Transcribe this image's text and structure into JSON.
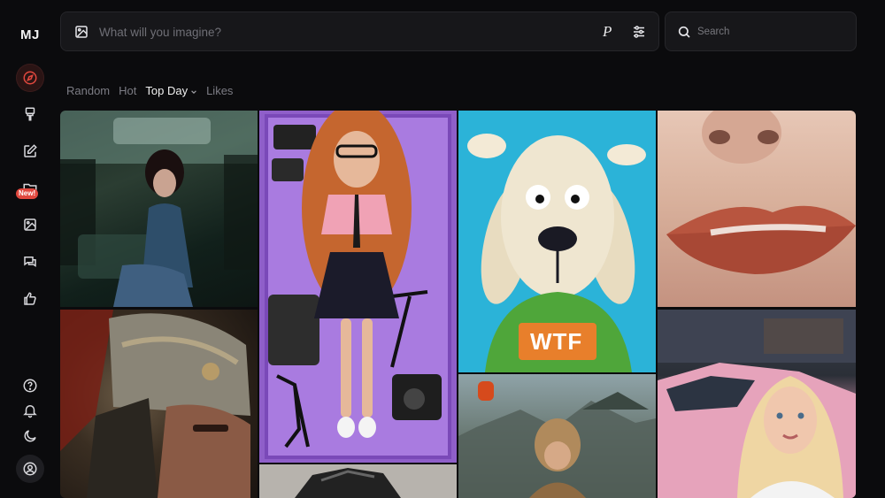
{
  "app": {
    "logo": "MJ"
  },
  "sidebar": {
    "items": [
      {
        "name": "explore",
        "icon": "compass-icon",
        "active": true
      },
      {
        "name": "create",
        "icon": "brush-icon"
      },
      {
        "name": "edit",
        "icon": "edit-icon"
      },
      {
        "name": "personalize",
        "icon": "folder-icon",
        "badge": "New!"
      },
      {
        "name": "organize",
        "icon": "image-icon"
      },
      {
        "name": "chat",
        "icon": "chat-icon"
      },
      {
        "name": "rank",
        "icon": "thumbs-up-icon"
      }
    ],
    "bottom": [
      {
        "name": "help",
        "icon": "help-icon"
      },
      {
        "name": "notifications",
        "icon": "bell-icon"
      },
      {
        "name": "theme",
        "icon": "moon-icon"
      },
      {
        "name": "account",
        "icon": "user-icon"
      }
    ]
  },
  "prompt": {
    "placeholder": "What will you imagine?",
    "p_label": "P"
  },
  "search": {
    "placeholder": "Search"
  },
  "filters": {
    "items": [
      "Random",
      "Hot",
      "Top Day",
      "Likes"
    ],
    "active": "Top Day"
  },
  "gallery": {
    "tiles": [
      {
        "subject": "woman in train"
      },
      {
        "subject": "armored warrior"
      },
      {
        "subject": "doll in purple box"
      },
      {
        "subject": "rock sculpture"
      },
      {
        "subject": "knitted dog WTF sweater",
        "text": "WTF"
      },
      {
        "subject": "monkey temple"
      },
      {
        "subject": "lips close-up"
      },
      {
        "subject": "woman and pink car"
      }
    ]
  },
  "colors": {
    "background": "#0b0b0d",
    "accent": "#e0483e",
    "panel": "#17171a"
  }
}
